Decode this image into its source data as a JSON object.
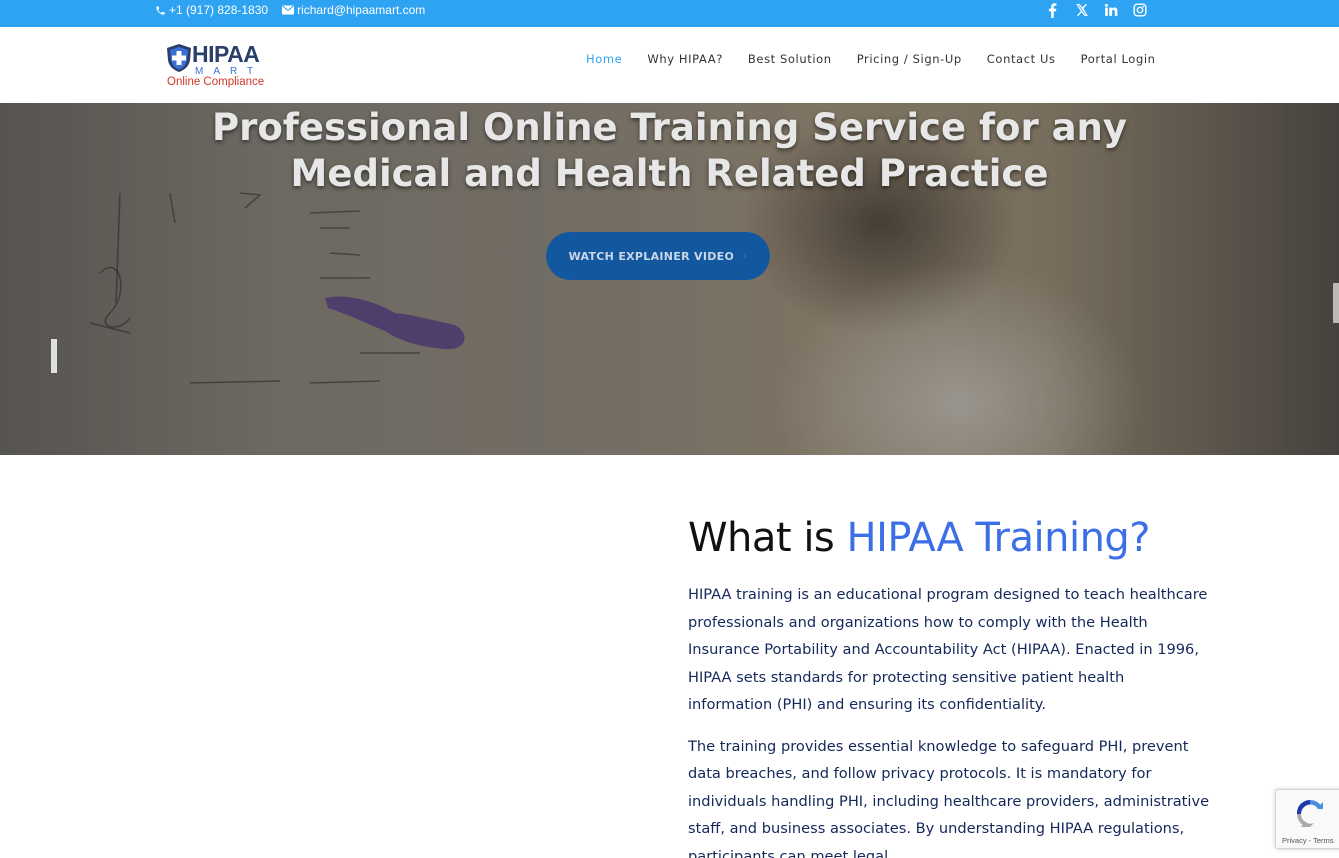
{
  "topbar": {
    "phone": "+1 (917) 828-1830",
    "email": "richard@hipaamart.com",
    "phone_icon": "phone-icon",
    "email_icon": "envelope-icon",
    "social": [
      "facebook-icon",
      "x-icon",
      "linkedin-icon",
      "instagram-icon"
    ]
  },
  "logo": {
    "word": "HIPAA",
    "sub": "MART",
    "tagline": "Online Compliance"
  },
  "nav": {
    "items": [
      {
        "label": "Home",
        "active": true
      },
      {
        "label": "Why HIPAA?"
      },
      {
        "label": "Best Solution"
      },
      {
        "label": "Pricing / Sign-Up"
      },
      {
        "label": "Contact Us"
      },
      {
        "label": "Portal Login"
      }
    ]
  },
  "hero": {
    "headline_line1": "Professional Online Training Service for any",
    "headline_line2": "Medical and Health Related Practice",
    "cta_label": "WATCH EXPLAINER VIDEO",
    "cta_arrow": "›"
  },
  "section": {
    "title_plain": "What is ",
    "title_accent": "HIPAA Training?",
    "para1": "HIPAA training is an educational program designed to teach healthcare professionals and organizations how to comply with the Health Insurance Portability and Accountability Act (HIPAA). Enacted in 1996, HIPAA sets standards for protecting sensitive patient health information (PHI) and ensuring its confidentiality.",
    "para2": "The training provides essential knowledge to safeguard PHI, prevent data breaches, and follow privacy protocols. It is mandatory for individuals handling PHI, including healthcare providers, administrative staff, and business associates. By understanding HIPAA regulations, participants can meet legal"
  },
  "recaptcha": {
    "label": "Privacy - Terms"
  },
  "colors": {
    "topbar": "#2ea3f2",
    "nav_active": "#2ea3f2",
    "accent": "#3c6fe6",
    "cta": "#13579f",
    "body_text": "#14285a"
  }
}
